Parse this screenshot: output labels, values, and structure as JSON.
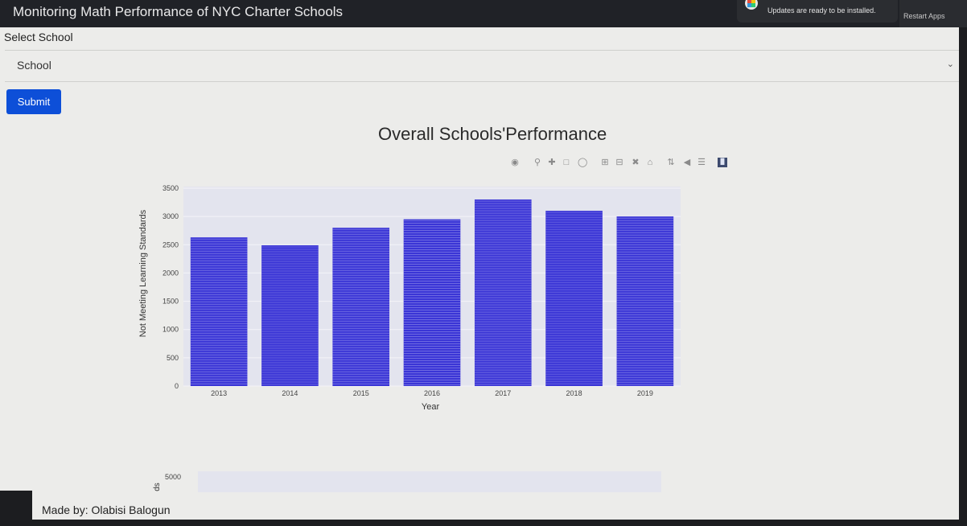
{
  "app": {
    "title": "Monitoring Math Performance of NYC Charter Schools"
  },
  "notification": {
    "message": "Updates are ready to be installed.",
    "action_label": "Restart Apps"
  },
  "form": {
    "select_label": "Select School",
    "dropdown_placeholder": "School",
    "submit_label": "Submit"
  },
  "footer": {
    "credit": "Made by: Olabisi Balogun"
  },
  "colors": {
    "bar": "#3a35d6",
    "plot_bg": "#e3e4ee",
    "submit": "#0d4fd8"
  },
  "modebar_icons": [
    "camera-icon",
    "zoom-icon",
    "pan-icon",
    "box-select-icon",
    "lasso-icon",
    "zoom-in-icon",
    "zoom-out-icon",
    "autoscale-icon",
    "reset-axes-icon",
    "spike-lines-icon",
    "hover-closest-icon",
    "hover-compare-icon",
    "plotly-logo-icon"
  ],
  "chart_data": [
    {
      "type": "bar",
      "title": "Overall Schools'Performance",
      "xlabel": "Year",
      "ylabel": "Not Meeting Learning Standards",
      "categories": [
        "2013",
        "2014",
        "2015",
        "2016",
        "2017",
        "2018",
        "2019"
      ],
      "values": [
        2630,
        2490,
        2800,
        2950,
        3300,
        3100,
        3000
      ],
      "yticks": [
        0,
        500,
        1000,
        1500,
        2000,
        2500,
        3000,
        3500
      ],
      "ylim": [
        0,
        3500
      ],
      "grid": true
    },
    {
      "type": "bar",
      "title": "",
      "ylabel": "ds",
      "yticks": [
        5000
      ],
      "grid": true
    }
  ]
}
